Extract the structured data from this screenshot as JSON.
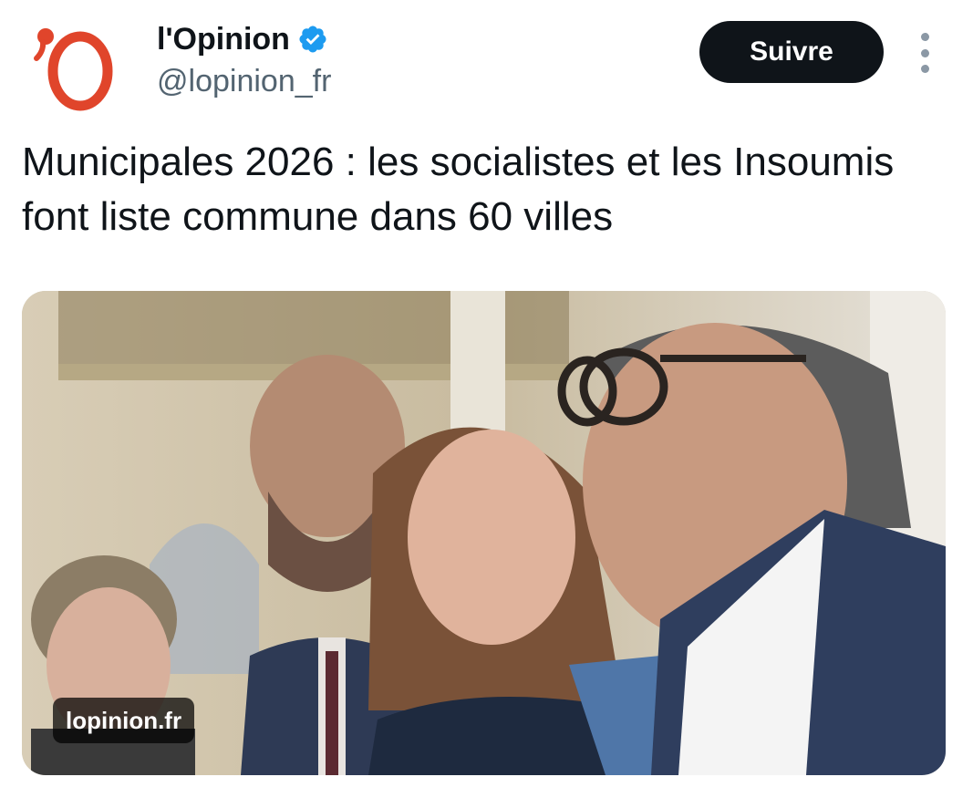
{
  "account": {
    "logo_text": "'O",
    "display_name": "l'Opinion",
    "handle": "@lopinion_fr",
    "verified": true
  },
  "actions": {
    "follow_label": "Suivre",
    "more_icon": "more-vertical-icon"
  },
  "tweet": {
    "text": "Municipales 2026 : les socialistes et les Insoumis font liste commune dans 60 villes"
  },
  "media": {
    "link_domain": "lopinion.fr"
  },
  "colors": {
    "logo_red": "#e0452b",
    "verified_blue": "#1d9bf0",
    "button_bg": "#0f1419",
    "handle_gray": "#536471"
  }
}
